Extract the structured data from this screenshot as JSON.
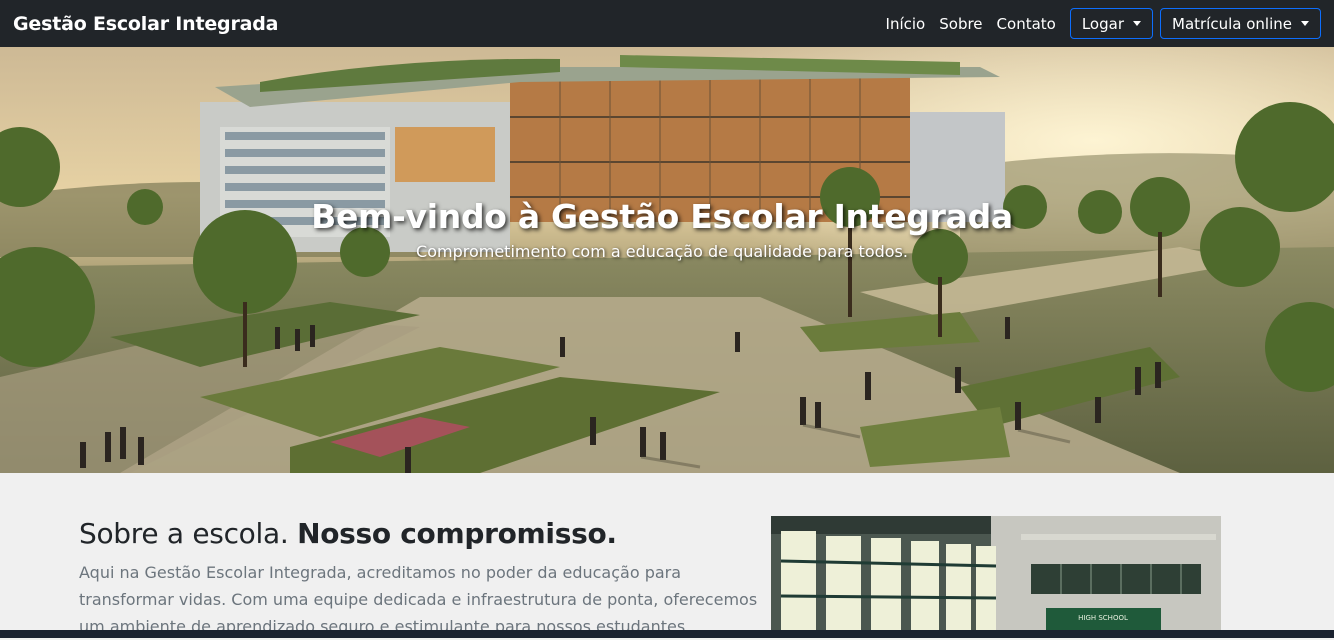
{
  "navbar": {
    "brand": "Gestão Escolar Integrada",
    "links": [
      "Início",
      "Sobre",
      "Contato"
    ],
    "login_label": "Logar",
    "enroll_label": "Matrícula online"
  },
  "hero": {
    "title": "Bem-vindo à Gestão Escolar Integrada",
    "subtitle": "Comprometimento com a educação de qualidade para todos."
  },
  "about": {
    "title_light": "Sobre a escola.",
    "title_bold": "Nosso compromisso.",
    "text": "Aqui na Gestão Escolar Integrada, acreditamos no poder da educação para transformar vidas. Com uma equipe dedicada e infraestrutura de ponta, oferecemos um ambiente de aprendizado seguro e estimulante para nossos estudantes.",
    "image_board_text": "HIGH SCHOOL"
  },
  "colors": {
    "navbar_bg": "#212529",
    "dropdown_border": "#0d6efd",
    "page_bg": "#f0f0f0"
  }
}
